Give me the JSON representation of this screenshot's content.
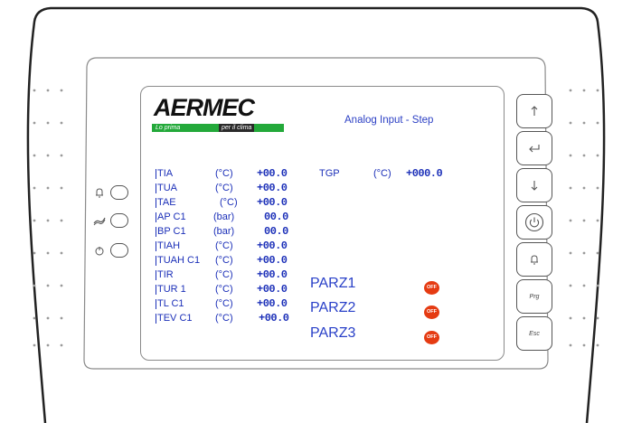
{
  "device": {
    "brand": "AERMEC",
    "tagline_left": "Lo prima",
    "tagline_right": "per il clima"
  },
  "screen": {
    "title": "Analog Input - Step",
    "rows": [
      {
        "name": "TIA",
        "unit": "(°C)",
        "value": "+00.0"
      },
      {
        "name": "TUA",
        "unit": "(°C)",
        "value": "+00.0"
      },
      {
        "name": "TAE",
        "unit": "(°C)",
        "value": "+00.0"
      },
      {
        "name": "AP C1",
        "unit": "(bar)",
        "value": "00.0"
      },
      {
        "name": "BP C1",
        "unit": "(bar)",
        "value": "00.0"
      },
      {
        "name": "TIAH",
        "unit": "(°C)",
        "value": "+00.0"
      },
      {
        "name": "TUAH C1",
        "unit": "(°C)",
        "value": "+00.0"
      },
      {
        "name": "TIR",
        "unit": "(°C)",
        "value": "+00.0"
      },
      {
        "name": "TUR 1",
        "unit": "(°C)",
        "value": "+00.0"
      },
      {
        "name": "TL C1",
        "unit": "(°C)",
        "value": "+00.0"
      },
      {
        "name": "TEV C1",
        "unit": "(°C)",
        "value": "+00.0"
      }
    ],
    "tgp": {
      "name": "TGP",
      "unit": "(°C)",
      "value": "+000.0"
    },
    "parz": [
      {
        "label": "PARZ1",
        "status": "OFF"
      },
      {
        "label": "PARZ2",
        "status": "OFF"
      },
      {
        "label": "PARZ3",
        "status": "OFF"
      }
    ]
  },
  "keys": {
    "prg_label": "Prg",
    "esc_label": "Esc"
  },
  "icons": {
    "left_leds": [
      "bell-icon",
      "flow-icon",
      "power-icon"
    ],
    "keypad": [
      "arrow-up-icon",
      "enter-icon",
      "arrow-down-icon",
      "power-icon",
      "alarm-bell-icon"
    ]
  },
  "colors": {
    "text_blue": "#1b2fb8",
    "off_red": "#e53b12",
    "logo_green": "#23a93a"
  }
}
